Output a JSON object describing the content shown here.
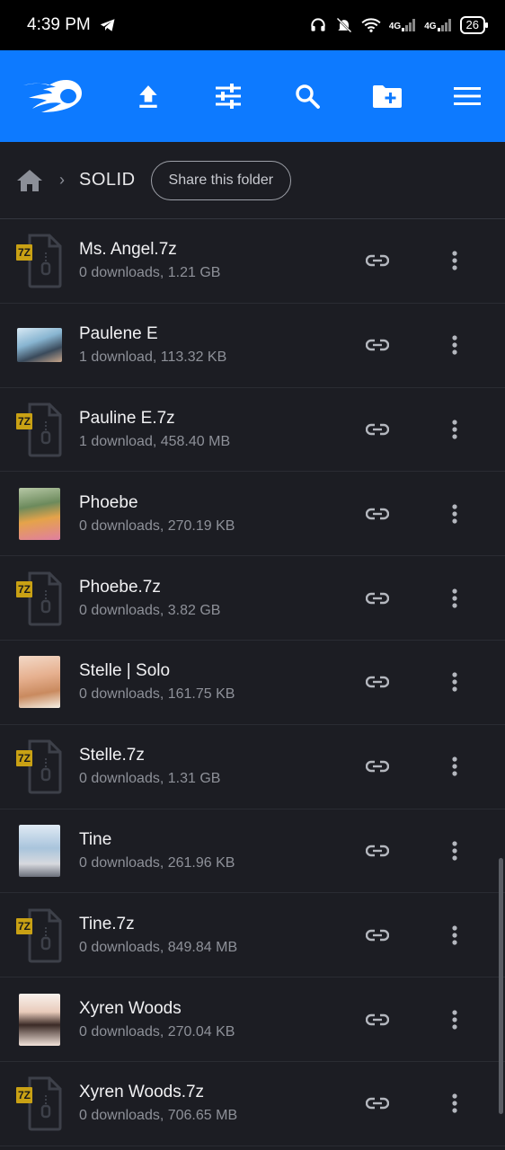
{
  "status": {
    "time": "4:39 PM",
    "net1": "4G",
    "net2": "4G",
    "battery": "26"
  },
  "breadcrumb": {
    "folder": "SOLID",
    "share_label": "Share this folder"
  },
  "files": [
    {
      "name": "Ms. Angel.7z",
      "meta": "0 downloads, 1.21 GB",
      "kind": "7z",
      "badge": "7Z"
    },
    {
      "name": "Paulene E",
      "meta": "1 download, 113.32 KB",
      "kind": "photo-wide"
    },
    {
      "name": "Pauline E.7z",
      "meta": "1 download, 458.40 MB",
      "kind": "7z",
      "badge": "7Z"
    },
    {
      "name": "Phoebe",
      "meta": "0 downloads, 270.19 KB",
      "kind": "photo"
    },
    {
      "name": "Phoebe.7z",
      "meta": "0 downloads, 3.82 GB",
      "kind": "7z",
      "badge": "7Z"
    },
    {
      "name": "Stelle | Solo",
      "meta": "0 downloads, 161.75 KB",
      "kind": "photo"
    },
    {
      "name": "Stelle.7z",
      "meta": "0 downloads, 1.31 GB",
      "kind": "7z",
      "badge": "7Z"
    },
    {
      "name": "Tine",
      "meta": "0 downloads, 261.96 KB",
      "kind": "photo"
    },
    {
      "name": "Tine.7z",
      "meta": "0 downloads, 849.84 MB",
      "kind": "7z",
      "badge": "7Z"
    },
    {
      "name": "Xyren Woods",
      "meta": "0 downloads, 270.04 KB",
      "kind": "photo"
    },
    {
      "name": "Xyren Woods.7z",
      "meta": "0 downloads, 706.65 MB",
      "kind": "7z",
      "badge": "7Z"
    }
  ],
  "colors": {
    "brand": "#0d7aff",
    "background": "#1c1d23",
    "archive_badge": "#c9a114"
  }
}
